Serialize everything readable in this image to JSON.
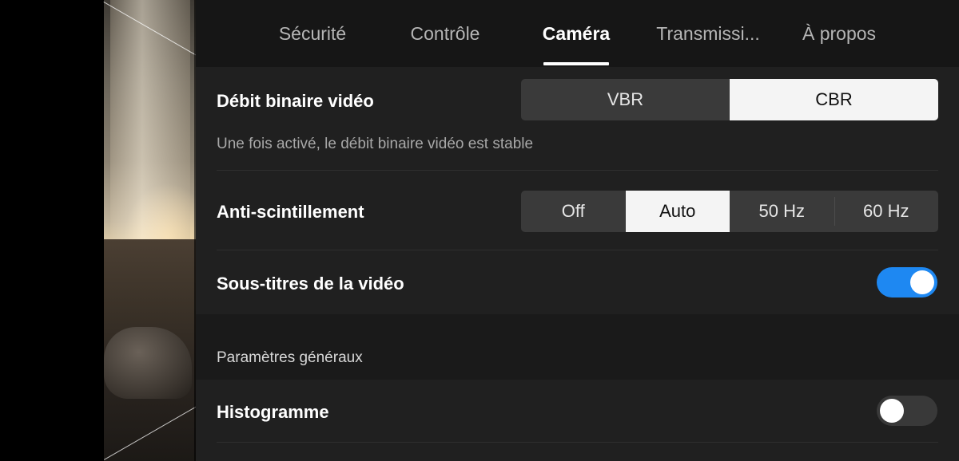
{
  "tabs": [
    {
      "label": "Sécurité",
      "active": false
    },
    {
      "label": "Contrôle",
      "active": false
    },
    {
      "label": "Caméra",
      "active": true
    },
    {
      "label": "Transmissi...",
      "active": false
    },
    {
      "label": "À propos",
      "active": false
    }
  ],
  "bitrate": {
    "label": "Débit binaire vidéo",
    "options": [
      "VBR",
      "CBR"
    ],
    "selected": "CBR",
    "description": "Une fois activé, le débit binaire vidéo est stable"
  },
  "antiflicker": {
    "label": "Anti-scintillement",
    "options": [
      "Off",
      "Auto",
      "50 Hz",
      "60 Hz"
    ],
    "selected": "Auto"
  },
  "subtitles": {
    "label": "Sous-titres de la vidéo",
    "enabled": true
  },
  "general": {
    "section_title": "Paramètres généraux",
    "histogram_label": "Histogramme",
    "histogram_enabled": false
  },
  "colors": {
    "accent": "#1e88f2",
    "panel_bg": "#1d1d1d"
  }
}
